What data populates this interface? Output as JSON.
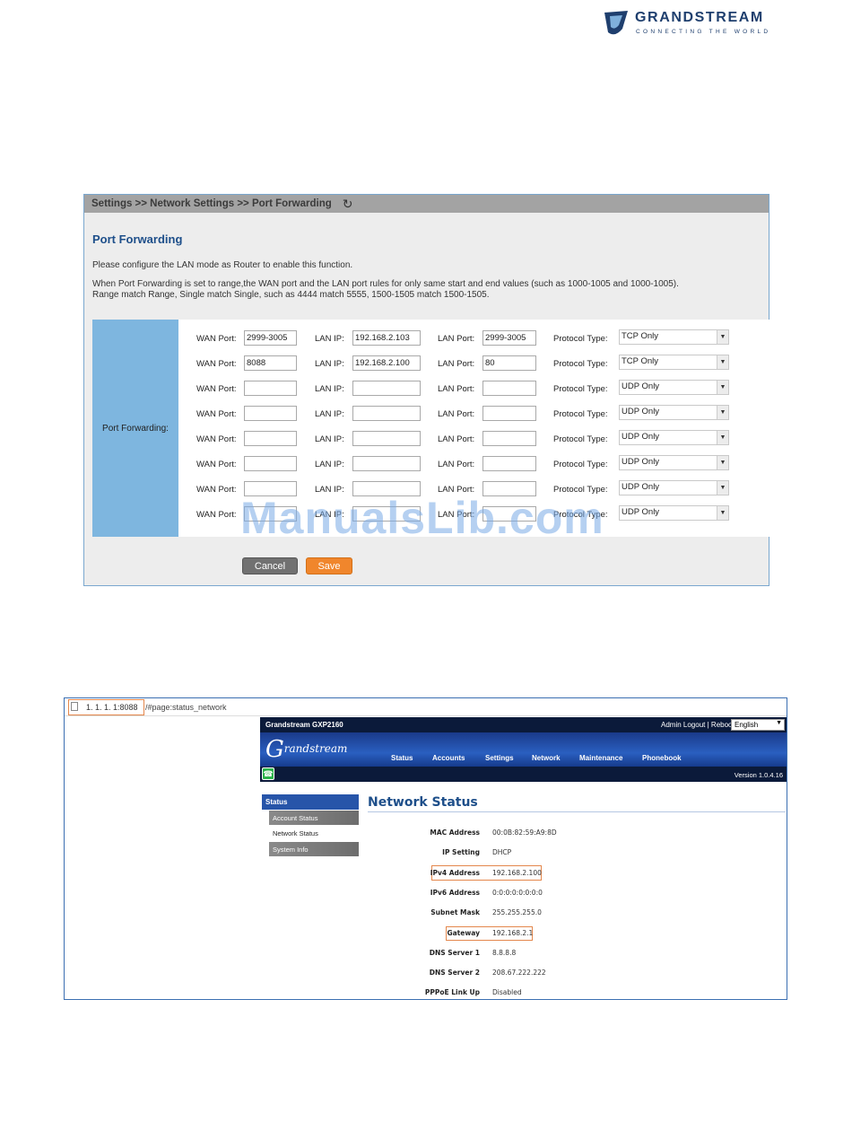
{
  "logo": {
    "brand": "GRANDSTREAM",
    "tagline": "CONNECTING THE WORLD"
  },
  "port_forwarding": {
    "breadcrumb": "Settings >> Network Settings >> Port Forwarding",
    "title": "Port Forwarding",
    "note1": "Please configure the LAN mode as Router to enable this function.",
    "note2": "When Port Forwarding is set to range,the WAN port and the LAN port rules for only same start and end values (such as 1000-1005 and 1000-1005).",
    "note3": "Range match Range, Single match Single, such as 4444 match 5555, 1500-1505 match 1500-1505.",
    "section_label": "Port Forwarding:",
    "labels": {
      "wan_port": "WAN Port:",
      "lan_ip": "LAN IP:",
      "lan_port": "LAN Port:",
      "protocol": "Protocol Type:"
    },
    "rows": [
      {
        "wan": "2999-3005",
        "ip": "192.168.2.103",
        "lan": "2999-3005",
        "proto": "TCP Only"
      },
      {
        "wan": "8088",
        "ip": "192.168.2.100",
        "lan": "80",
        "proto": "TCP Only"
      },
      {
        "wan": "",
        "ip": "",
        "lan": "",
        "proto": "UDP Only"
      },
      {
        "wan": "",
        "ip": "",
        "lan": "",
        "proto": "UDP Only"
      },
      {
        "wan": "",
        "ip": "",
        "lan": "",
        "proto": "UDP Only"
      },
      {
        "wan": "",
        "ip": "",
        "lan": "",
        "proto": "UDP Only"
      },
      {
        "wan": "",
        "ip": "",
        "lan": "",
        "proto": "UDP Only"
      },
      {
        "wan": "",
        "ip": "",
        "lan": "",
        "proto": "UDP Only"
      }
    ],
    "cancel_label": "Cancel",
    "save_label": "Save"
  },
  "watermark": "ManualsLib.com",
  "network_status": {
    "url_host": "1. 1. 1. 1:8088",
    "url_path": "/#page:status_network",
    "model": "Grandstream GXP2160",
    "admin_logout": "Admin Logout",
    "reboot": "Reboot",
    "language": "English",
    "brand_script": "randstream",
    "brand_initial": "G",
    "menu": [
      "Status",
      "Accounts",
      "Settings",
      "Network",
      "Maintenance",
      "Phonebook"
    ],
    "version": "Version 1.0.4.16",
    "sidebar": {
      "status": "Status",
      "account_status": "Account Status",
      "network_status": "Network Status",
      "system_info": "System Info"
    },
    "title": "Network Status",
    "fields": [
      {
        "key": "MAC Address",
        "value": "00:0B:82:59:A9:8D"
      },
      {
        "key": "IP Setting",
        "value": "DHCP"
      },
      {
        "key": "IPv4 Address",
        "value": "192.168.2.100"
      },
      {
        "key": "IPv6 Address",
        "value": "0:0:0:0:0:0:0:0"
      },
      {
        "key": "Subnet Mask",
        "value": "255.255.255.0"
      },
      {
        "key": "Gateway",
        "value": "192.168.2.1"
      },
      {
        "key": "DNS Server 1",
        "value": "8.8.8.8"
      },
      {
        "key": "DNS Server 2",
        "value": "208.67.222.222"
      },
      {
        "key": "PPPoE Link Up",
        "value": "Disabled"
      }
    ]
  },
  "colors": {
    "accent_blue": "#1e4f8a",
    "save_orange": "#f0862c",
    "highlight_orange": "#e4874c",
    "label_col_blue": "#7eb6df"
  }
}
